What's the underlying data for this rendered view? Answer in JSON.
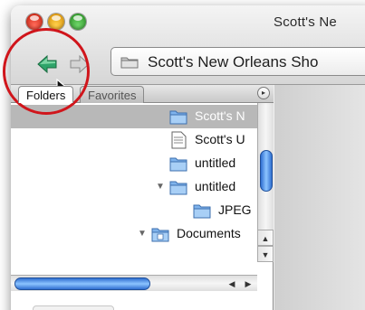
{
  "window": {
    "title": "Scott's Ne"
  },
  "toolbar": {
    "back_icon": "green-left-arrow",
    "forward_icon": "gray-right-arrow",
    "path_text": "Scott's New Orleans Sho",
    "path_icon": "folder-icon"
  },
  "sidebar": {
    "tabs": [
      {
        "label": "Folders",
        "active": true
      },
      {
        "label": "Favorites",
        "active": false
      }
    ],
    "rows": [
      {
        "label": "Scott's N",
        "selected": true,
        "expanded": null
      },
      {
        "label": "Scott's U",
        "selected": false,
        "expanded": null
      },
      {
        "label": "untitled",
        "selected": false,
        "expanded": null
      },
      {
        "label": "untitled",
        "selected": false,
        "expanded": true
      },
      {
        "label": "JPEG",
        "selected": false,
        "expanded": null
      },
      {
        "label": "Documents",
        "selected": false,
        "expanded": true
      }
    ]
  },
  "colors": {
    "highlight_circle": "#d0151b",
    "scroll_thumb": "#4a90e2",
    "selection": "#b8b8b8"
  }
}
